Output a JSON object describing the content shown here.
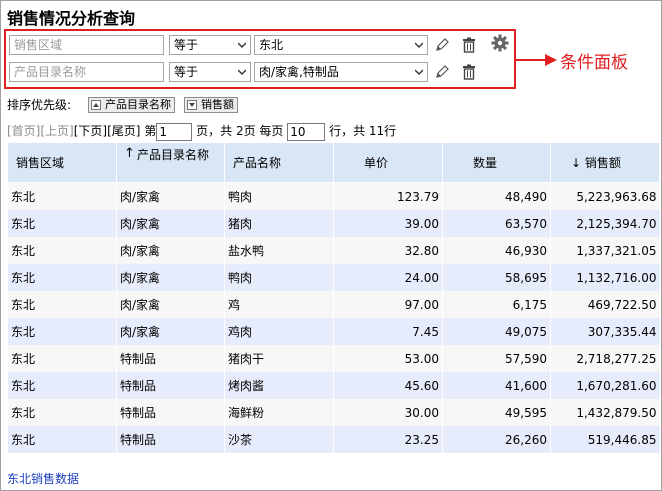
{
  "page": {
    "title": "销售情况分析查询",
    "callout": "条件面板",
    "footer_link": "东北销售数据"
  },
  "conditions": [
    {
      "field": "销售区域",
      "operator": "等于",
      "value": "东北"
    },
    {
      "field": "产品目录名称",
      "operator": "等于",
      "value": "肉/家禽,特制品"
    }
  ],
  "sort": {
    "label": "排序优先级:",
    "items": [
      "产品目录名称",
      "销售额"
    ]
  },
  "pager": {
    "first": "[首页]",
    "prev": "[上页]",
    "next": "[下页]",
    "last": "[尾页]",
    "page_prefix": "第",
    "current_page": "1",
    "page_mid": "页，共 2页 每页",
    "page_size": "10",
    "page_suffix": "行，共 11行"
  },
  "table": {
    "columns": [
      "销售区域",
      "产品目录名称",
      "产品名称",
      "单价",
      "数量",
      "销售额"
    ],
    "sort_indicators": {
      "col1": "↑",
      "col5": "↓"
    },
    "rows": [
      [
        "东北",
        "肉/家禽",
        "鸭肉",
        "123.79",
        "48,490",
        "5,223,963.68"
      ],
      [
        "东北",
        "肉/家禽",
        "猪肉",
        "39.00",
        "63,570",
        "2,125,394.70"
      ],
      [
        "东北",
        "肉/家禽",
        "盐水鸭",
        "32.80",
        "46,930",
        "1,337,321.05"
      ],
      [
        "东北",
        "肉/家禽",
        "鸭肉",
        "24.00",
        "58,695",
        "1,132,716.00"
      ],
      [
        "东北",
        "肉/家禽",
        "鸡",
        "97.00",
        "6,175",
        "469,722.50"
      ],
      [
        "东北",
        "肉/家禽",
        "鸡肉",
        "7.45",
        "49,075",
        "307,335.44"
      ],
      [
        "东北",
        "特制品",
        "猪肉干",
        "53.00",
        "57,590",
        "2,718,277.25"
      ],
      [
        "东北",
        "特制品",
        "烤肉酱",
        "45.60",
        "41,600",
        "1,670,281.60"
      ],
      [
        "东北",
        "特制品",
        "海鲜粉",
        "30.00",
        "49,595",
        "1,432,879.50"
      ],
      [
        "东北",
        "特制品",
        "沙茶",
        "23.25",
        "26,260",
        "519,446.85"
      ]
    ]
  },
  "colors": {
    "accent_red": "#e02020",
    "header_bg": "#d9e6f5",
    "row_alt": "#e6ecfb",
    "link_blue": "#1f3fbf"
  },
  "icons": [
    "pencil-icon",
    "trash-icon",
    "gear-icon",
    "arrow-right-icon",
    "chevron-down-icon"
  ]
}
